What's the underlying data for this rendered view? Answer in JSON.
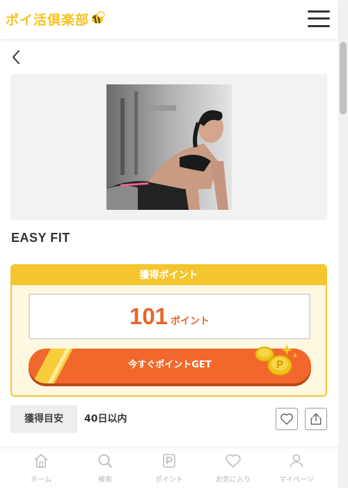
{
  "header": {
    "logo_text": "ポイ活倶楽部",
    "logo_icon": "bee-icon",
    "menu_icon": "hamburger-menu-icon"
  },
  "nav": {
    "back_icon": "chevron-left-icon"
  },
  "offer": {
    "title": "EASY FIT",
    "image_icon": "fitness-woman-photo"
  },
  "points": {
    "header_label": "獲得ポイント",
    "amount": "101",
    "unit": "ポイント",
    "cta_label": "今すぐポイントGET"
  },
  "meta": {
    "label": "獲得目安",
    "value": "40日以内",
    "favorite_icon": "heart-icon",
    "share_icon": "share-icon"
  },
  "tabbar": {
    "items": [
      {
        "label": "ホーム",
        "icon": "home-icon"
      },
      {
        "label": "検索",
        "icon": "search-icon"
      },
      {
        "label": "ポイント",
        "icon": "point-p-icon"
      },
      {
        "label": "お気に入り",
        "icon": "heart-icon"
      },
      {
        "label": "マイページ",
        "icon": "user-icon"
      }
    ]
  },
  "colors": {
    "brand_yellow": "#f4c52e",
    "accent_orange": "#f2682c",
    "points_text": "#e8652a",
    "tab_inactive": "#b5b5b5"
  }
}
